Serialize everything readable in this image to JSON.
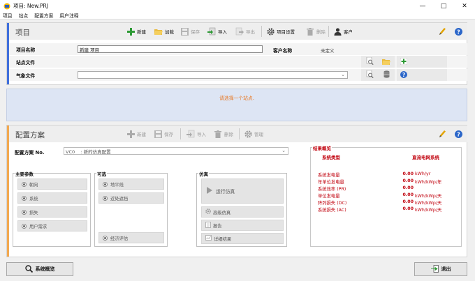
{
  "window": {
    "title": "项目: New.PRJ",
    "minimize": "—",
    "maximize": "□",
    "close": "✕"
  },
  "menu": [
    "项目",
    "站点",
    "配置方案",
    "用户注释"
  ],
  "project": {
    "title": "项目",
    "toolbar": {
      "new": "新建",
      "load": "加载",
      "save": "保存",
      "import": "导入",
      "export": "导出",
      "settings": "项目设置",
      "delete": "删除",
      "client": "客户"
    },
    "name_label": "项目名称",
    "name_value": "新建 项目",
    "client_label": "客户名称",
    "client_value": "未定义",
    "site_label": "站点文件",
    "meteo_label": "气象文件"
  },
  "site_notice": "请选择一个站点.",
  "variant": {
    "title": "配置方案",
    "toolbar": {
      "new": "新建",
      "save": "保存",
      "import": "导入",
      "delete": "删除",
      "manage": "管理"
    },
    "no_label": "配置方案 No.",
    "no_value": "VC0    : 新的仿真配置",
    "main_params": {
      "title": "主要参数",
      "items": [
        "朝向",
        "系统",
        "损失",
        "用户需求"
      ]
    },
    "optional": {
      "title": "可选",
      "items": [
        "地平线",
        "近处遮挡",
        "经济评估"
      ]
    },
    "simulation": {
      "title": "仿真",
      "run": "运行仿真",
      "advanced": "高级仿真",
      "report": "报告",
      "detailed": "详细结果"
    },
    "results": {
      "title": "结果概览",
      "col1": "系统类型",
      "col2": "直流电网系统",
      "rows": [
        {
          "label": "系统发电量",
          "value": "0.00",
          "unit": "kWh/yr"
        },
        {
          "label": "年单位发电量",
          "value": "0.00",
          "unit": "kWh/kWp/年"
        },
        {
          "label": "系统效率 (PR)",
          "value": "0.00",
          "unit": ""
        },
        {
          "label": "单位发电量",
          "value": "0.00",
          "unit": "kWh/kWp/天"
        },
        {
          "label": "阵列损失 (DC)",
          "value": "0.00",
          "unit": "kWh/kWp/天"
        },
        {
          "label": "系统损失 (AC)",
          "value": "0.00",
          "unit": "kWh/kWp/天"
        }
      ]
    }
  },
  "bottom": {
    "overview": "系统概览",
    "exit": "退出"
  },
  "colors": {
    "accent_blue": "#3f6fdc",
    "accent_orange": "#f2a850",
    "notice_orange": "#e87722",
    "notice_bg": "#dde5f4",
    "result_red": "#c0000c"
  }
}
